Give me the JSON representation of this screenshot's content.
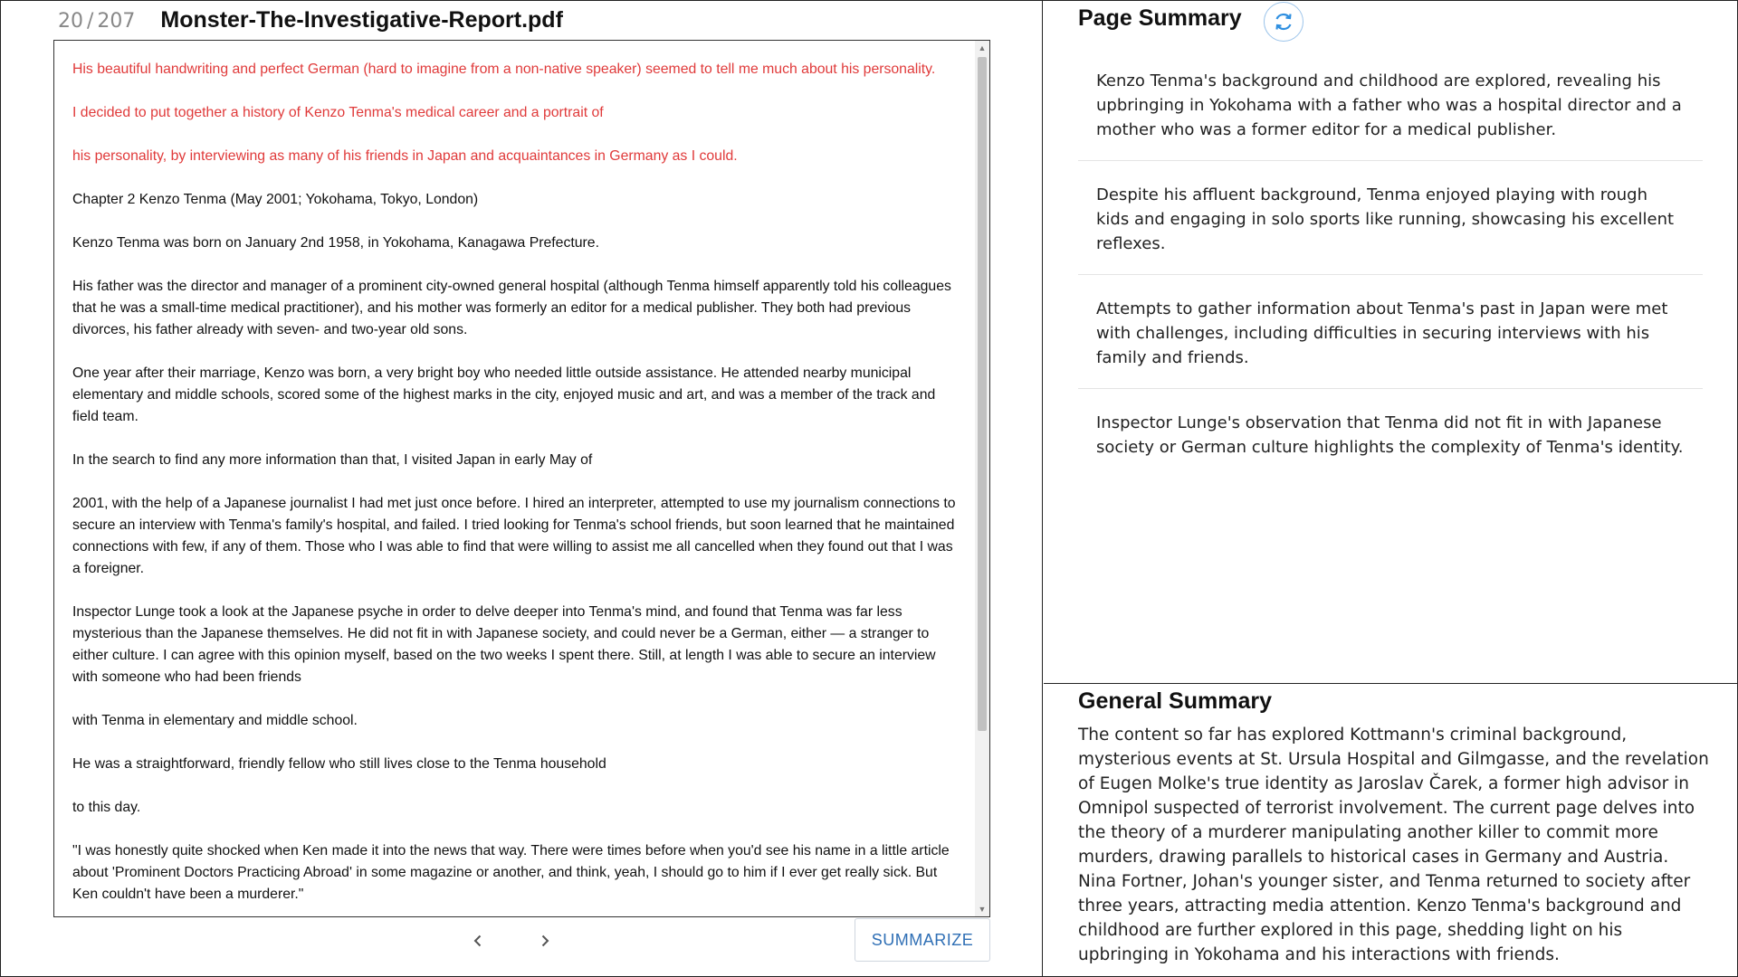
{
  "pager": {
    "current": "20",
    "separator": "/",
    "total": "207"
  },
  "document": {
    "filename": "Monster-The-Investigative-Report.pdf",
    "paragraphs": [
      {
        "text": "His beautiful handwriting and perfect German (hard to imagine from a non-native speaker) seemed to tell me much about his personality.",
        "highlight": true
      },
      {
        "text": "I decided to put together a history of Kenzo Tenma's medical career and a portrait of",
        "highlight": true
      },
      {
        "text": "his personality, by interviewing as many of his friends in Japan and acquaintances in Germany as I could.",
        "highlight": true
      },
      {
        "text": "Chapter 2 Kenzo Tenma (May 2001; Yokohama, Tokyo, London)",
        "highlight": false
      },
      {
        "text": "Kenzo Tenma was born on January 2nd 1958, in Yokohama, Kanagawa Prefecture.",
        "highlight": false
      },
      {
        "text": "His father was the director and manager of a prominent city-owned general hospital (although Tenma himself apparently told his colleagues that he was a small-time medical practitioner), and his mother was formerly an editor for a medical publisher. They both had previous divorces, his father already with seven- and two-year old sons.",
        "highlight": false
      },
      {
        "text": "One year after their marriage, Kenzo was born, a very bright boy who needed little outside assistance. He attended nearby municipal elementary and middle schools, scored some of the highest marks in the city, enjoyed music and art, and was a member of the track and field team.",
        "highlight": false
      },
      {
        "text": "In the search to find any more information than that, I visited Japan in early May of",
        "highlight": false
      },
      {
        "text": "2001, with the help of a Japanese journalist I had met just once before. I hired an interpreter, attempted to use my journalism connections to secure an interview with Tenma's family's hospital, and failed. I tried looking for Tenma's school friends, but soon learned that he maintained connections with few, if any of them. Those who I was able to find that were willing to assist me all cancelled when they found out that I was a foreigner.",
        "highlight": false
      },
      {
        "text": "Inspector Lunge took a look at the Japanese psyche in order to delve deeper into Tenma's mind, and found that Tenma was far less mysterious than the Japanese themselves. He did not fit in with Japanese society, and could never be a German, either — a stranger to either culture. I can agree with this opinion myself, based on the two weeks I spent there. Still, at length I was able to secure an interview with someone who had been friends",
        "highlight": false
      },
      {
        "text": "with Tenma in elementary and middle school.",
        "highlight": false
      },
      {
        "text": "He was a straightforward, friendly fellow who still lives close to the Tenma household",
        "highlight": false
      },
      {
        "text": "to this day.",
        "highlight": false
      },
      {
        "text": "\"I was honestly quite shocked when Ken made it into the news that way. There were times before when you'd see his name in a little article about 'Prominent Doctors Practicing Abroad' in some magazine or another, and think, yeah, I should go to him if I ever get really sick. But Ken couldn't have been a murderer.\"",
        "highlight": false
      }
    ]
  },
  "controls": {
    "prev_icon": "chevron-left-icon",
    "next_icon": "chevron-right-icon",
    "summarize_label": "SUMMARIZE"
  },
  "page_summary": {
    "title": "Page Summary",
    "refresh_icon": "refresh-icon",
    "items": [
      "Kenzo Tenma's background and childhood are explored, revealing his upbringing in Yokohama with a father who was a hospital director and a mother who was a former editor for a medical publisher.",
      "Despite his affluent background, Tenma enjoyed playing with rough kids and engaging in solo sports like running, showcasing his excellent reflexes.",
      "Attempts to gather information about Tenma's past in Japan were met with challenges, including difficulties in securing interviews with his family and friends.",
      "Inspector Lunge's observation that Tenma did not fit in with Japanese society or German culture highlights the complexity of Tenma's identity."
    ]
  },
  "general_summary": {
    "title": "General Summary",
    "text": "The content so far has explored Kottmann's criminal background, mysterious events at St. Ursula Hospital and Gilmgasse, and the revelation of Eugen Molke's true identity as Jaroslav Čarek, a former high advisor in Omnipol suspected of terrorist involvement. The current page delves into the theory of a murderer manipulating another killer to commit more murders, drawing parallels to historical cases in Germany and Austria. Nina Fortner, Johan's younger sister, and Tenma returned to society after three years, attracting media attention. Kenzo Tenma's background and childhood are further explored in this page, shedding light on his upbringing in Yokohama and his interactions with friends."
  },
  "colors": {
    "highlight_text": "#e03a3a",
    "accent": "#2f6fb5",
    "refresh_border": "#9cc4ea"
  }
}
